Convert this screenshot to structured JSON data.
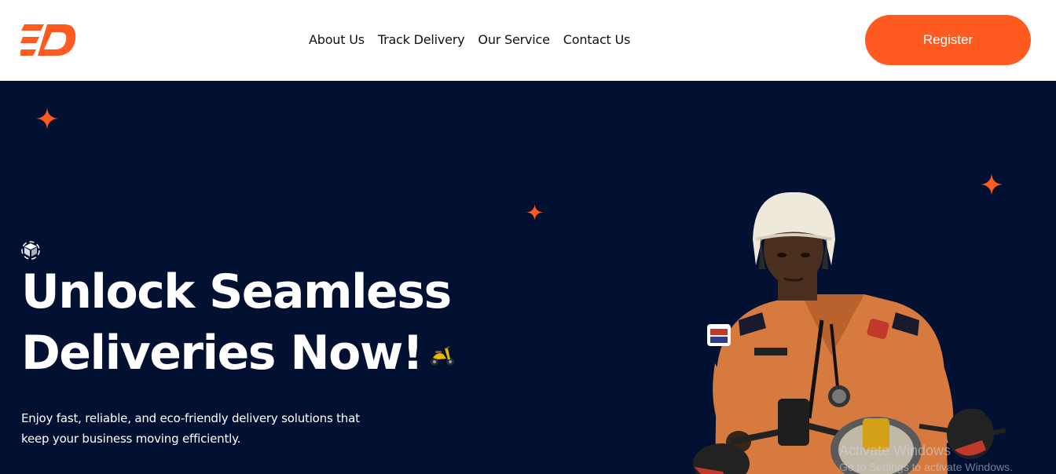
{
  "header": {
    "logo_icon": "brand-logo-icon",
    "nav": [
      "About Us",
      "Track Delivery",
      "Our Service",
      "Contact Us"
    ],
    "register_label": "Register"
  },
  "hero": {
    "headline": "Unlock Seamless Deliveries Now!",
    "subtext": "Enjoy fast, reliable, and eco-friendly delivery solutions that keep your business moving efficiently.",
    "image": "delivery-rider-on-scooter"
  },
  "colors": {
    "accent": "#ff5a1f",
    "hero_bg": "#021132",
    "header_bg": "#ffffff"
  },
  "watermark": {
    "title": "Activate Windows",
    "subtitle": "Go to Settings to activate Windows."
  }
}
